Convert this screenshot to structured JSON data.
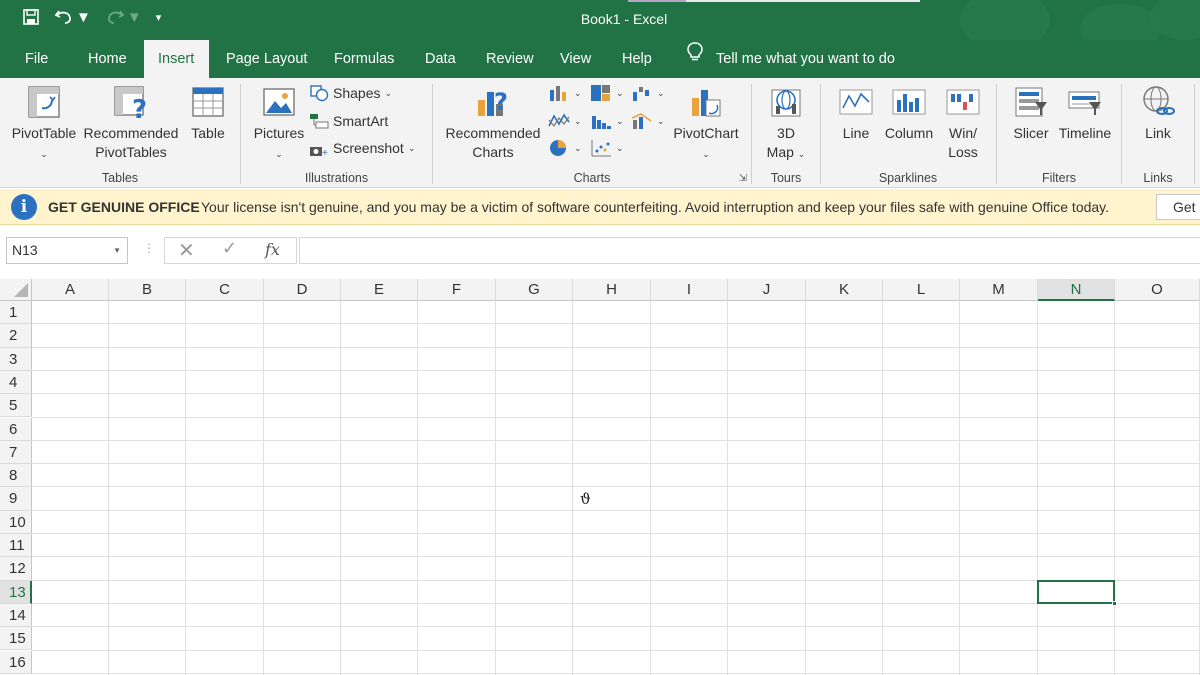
{
  "window": {
    "title": "Book1  -  Excel"
  },
  "quick_access": {
    "save_icon": "save-icon",
    "undo_icon": "undo-icon",
    "redo_icon": "redo-icon",
    "customize_icon": "customize-qat-icon"
  },
  "tabs": [
    {
      "label": "File"
    },
    {
      "label": "Home"
    },
    {
      "label": "Insert"
    },
    {
      "label": "Page Layout"
    },
    {
      "label": "Formulas"
    },
    {
      "label": "Data"
    },
    {
      "label": "Review"
    },
    {
      "label": "View"
    },
    {
      "label": "Help"
    }
  ],
  "active_tab": "Insert",
  "tell_me": {
    "label": "Tell me what you want to do"
  },
  "ribbon": {
    "tables": {
      "label": "Tables",
      "pivottable": "PivotTable",
      "recommended_line1": "Recommended",
      "recommended_line2": "PivotTables",
      "table": "Table"
    },
    "illustrations": {
      "label": "Illustrations",
      "pictures": "Pictures",
      "shapes": "Shapes",
      "smartart": "SmartArt",
      "screenshot": "Screenshot"
    },
    "charts": {
      "label": "Charts",
      "recommended_line1": "Recommended",
      "recommended_line2": "Charts",
      "pivotchart": "PivotChart"
    },
    "tours": {
      "label": "Tours",
      "map_line1": "3D",
      "map_line2": "Map"
    },
    "sparklines": {
      "label": "Sparklines",
      "line": "Line",
      "column": "Column",
      "winloss_line1": "Win/",
      "winloss_line2": "Loss"
    },
    "filters": {
      "label": "Filters",
      "slicer": "Slicer",
      "timeline": "Timeline"
    },
    "links": {
      "label": "Links",
      "link": "Link"
    }
  },
  "message_bar": {
    "title": "GET GENUINE OFFICE",
    "text": "Your license isn't genuine, and you may be a victim of software counterfeiting. Avoid interruption and keep your files safe with genuine Office today.",
    "button": "Get"
  },
  "formula_bar": {
    "name_box": "N13",
    "formula": ""
  },
  "grid": {
    "columns": [
      "A",
      "B",
      "C",
      "D",
      "E",
      "F",
      "G",
      "H",
      "I",
      "J",
      "K",
      "L",
      "M",
      "N",
      "O"
    ],
    "rows": [
      "1",
      "2",
      "3",
      "4",
      "5",
      "6",
      "7",
      "8",
      "9",
      "10",
      "11",
      "12",
      "13",
      "14",
      "15",
      "16"
    ],
    "selected_column": "N",
    "selected_row": "13",
    "cursor_glyph": "ϑ"
  },
  "colors": {
    "excel_green": "#217346",
    "ribbon_bg": "#f3f3f3",
    "message_bg": "#fff4ce",
    "info_blue": "#2b71c0"
  }
}
